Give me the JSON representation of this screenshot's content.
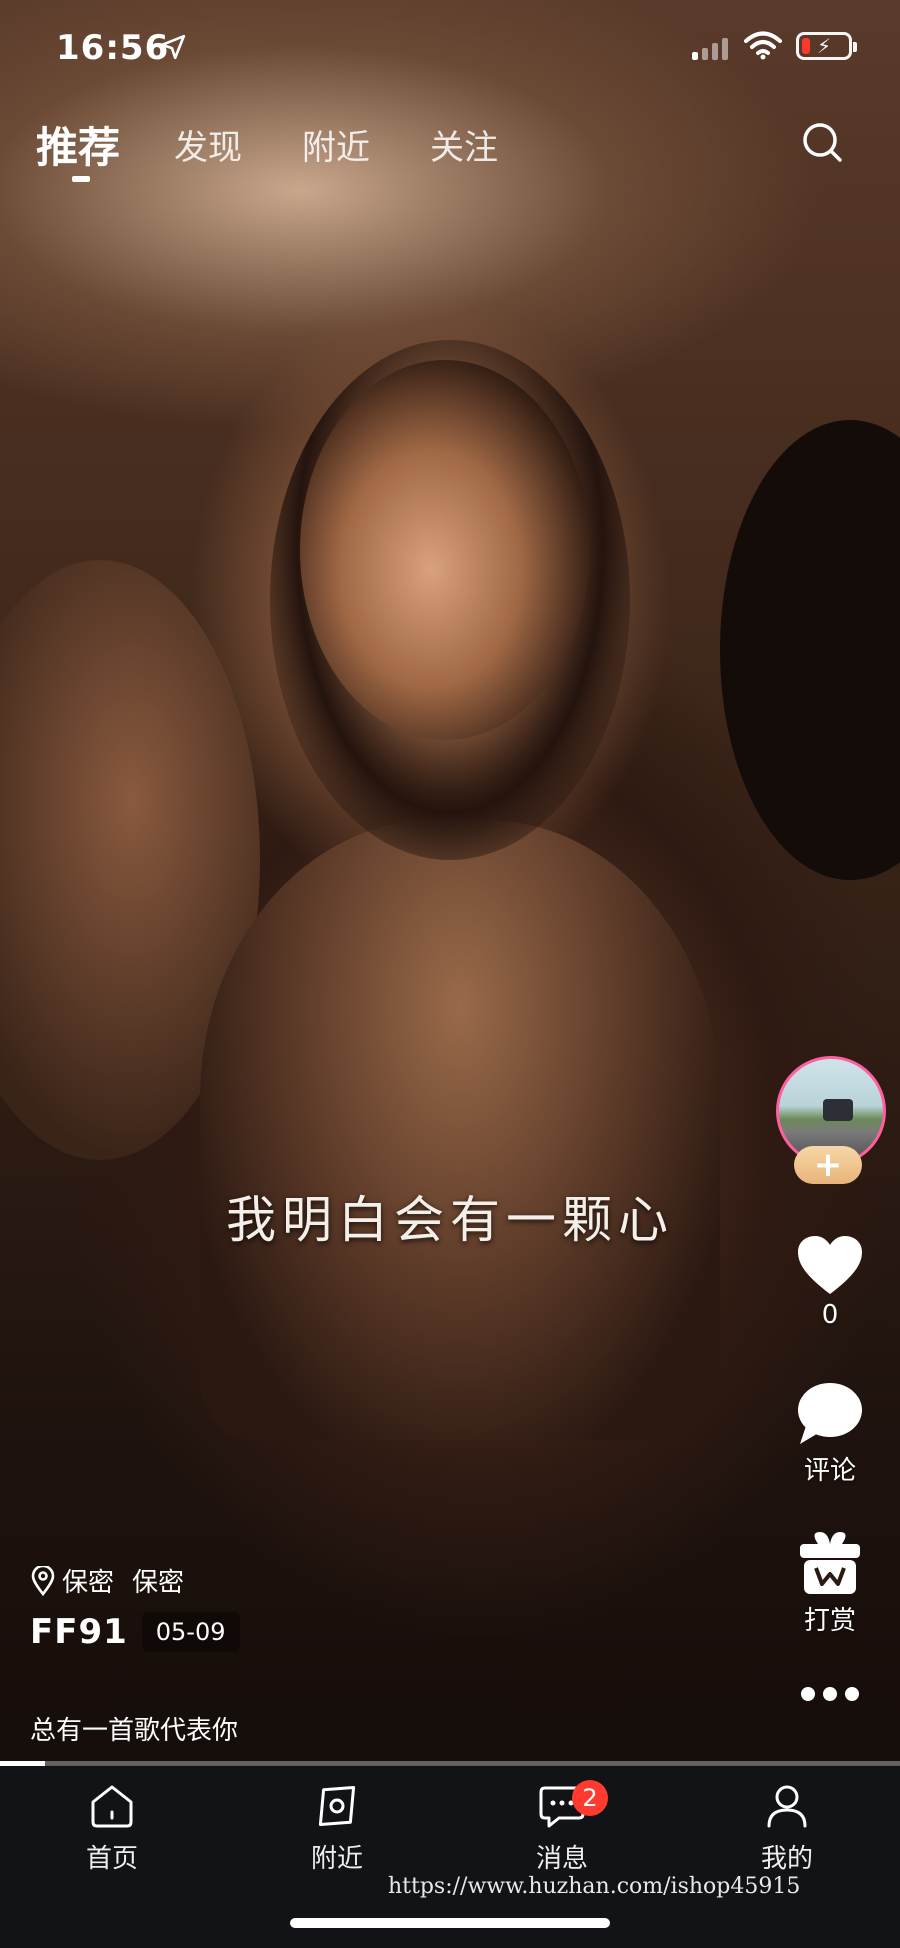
{
  "status_bar": {
    "time": "16:56",
    "location_icon": "location-arrow-icon",
    "signal_icon": "signal-icon",
    "wifi_icon": "wifi-icon",
    "battery_icon": "battery-charging-icon",
    "battery_level": 0.1
  },
  "top_tabs": {
    "items": [
      {
        "label": "推荐",
        "active": true
      },
      {
        "label": "发现",
        "active": false
      },
      {
        "label": "附近",
        "active": false
      },
      {
        "label": "关注",
        "active": false
      }
    ],
    "search_icon": "search-icon"
  },
  "video": {
    "subtitle": "我明白会有一颗心",
    "progress": 0.05
  },
  "side_actions": {
    "follow_label": "+",
    "like_count": "0",
    "comment_label": "评论",
    "gift_label": "打赏",
    "more_icon": "more-dots-icon"
  },
  "info": {
    "location_1": "保密",
    "location_2": "保密",
    "author": "FF91",
    "date": "05-09",
    "caption": "总有一首歌代表你"
  },
  "tabbar": {
    "items": [
      {
        "label": "首页",
        "icon": "home-icon"
      },
      {
        "label": "附近",
        "icon": "nearby-icon"
      },
      {
        "label": "消息",
        "icon": "message-icon",
        "badge": "2"
      },
      {
        "label": "我的",
        "icon": "profile-icon"
      }
    ]
  },
  "watermark": "https://www.huzhan.com/ishop45915",
  "colors": {
    "badge": "#ff3b30",
    "follow_button": "#e9b47b",
    "avatar_ring": "#ff5fa0",
    "tabbar_bg": "#121316"
  }
}
